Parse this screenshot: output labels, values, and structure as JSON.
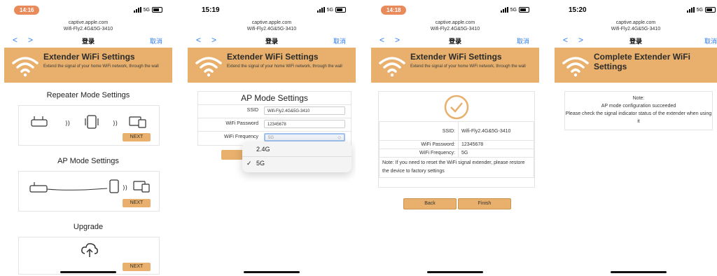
{
  "common": {
    "url_line1": "captive.apple.com",
    "url_line2": "Wifi-Fly2.4G&5G-3410",
    "nav_title": "登录",
    "cancel": "取消",
    "back_arrow": "<",
    "forward_arrow": ">",
    "net": "5G",
    "accent": "#e8b06c",
    "link_color": "#2d7cf6"
  },
  "phones": [
    {
      "time": "14:16",
      "banner_title": "Extender WiFi Settings",
      "banner_sub": "Extend the signal of your home WiFi network, through the wall",
      "sections": [
        {
          "title": "Repeater Mode Settings",
          "next": "NEXT"
        },
        {
          "title": "AP Mode Settings",
          "next": "NEXT"
        },
        {
          "title": "Upgrade",
          "next": "NEXT"
        }
      ]
    },
    {
      "time": "15:19",
      "banner_title": "Extender WiFi Settings",
      "banner_sub": "Extend the signal of your home WiFi network, through the wall",
      "form_title": "AP Mode Settings",
      "fields": [
        {
          "label": "SSID",
          "value": "Wifi-Fly2.4G&5G-3410"
        },
        {
          "label": "WiFi Password",
          "value": "12345678"
        },
        {
          "label": "WiFi Frequency",
          "value": "5G"
        }
      ],
      "dropdown": [
        "2.4G",
        "5G"
      ],
      "selected": "5G",
      "check": "✓"
    },
    {
      "time": "14:18",
      "banner_title": "Extender WiFi Settings",
      "banner_sub": "Extend the signal of your home WiFi network, through the wall",
      "rows": [
        {
          "label": "SSID:",
          "value": "Wifi-Fly2.4G&5G-3410"
        },
        {
          "label": "WiFi Password:",
          "value": "12345678"
        },
        {
          "label": "WiFi Frequency:",
          "value": "5G"
        }
      ],
      "note": "Note: If you need to reset the WiFi signal extender, please restore the device to factory settings",
      "back": "Back",
      "finish": "Finish"
    },
    {
      "time": "15:20",
      "banner_title": "Complete Extender WiFi Settings",
      "note_title": "Note:",
      "note_line1": "AP mode configuration succeeded",
      "note_line2": "Please check the signal indicator status of the extender when using it"
    }
  ]
}
